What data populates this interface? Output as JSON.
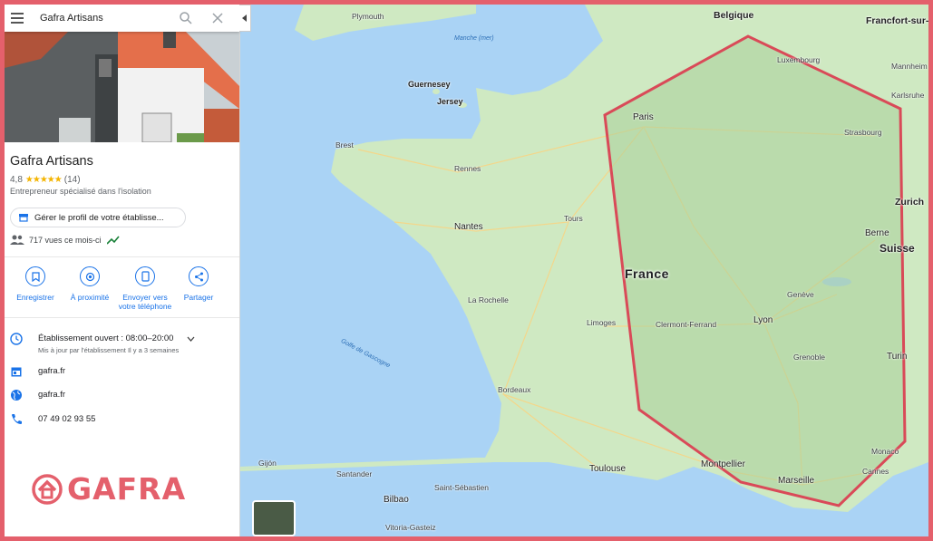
{
  "search": {
    "value": "Gafra Artisans"
  },
  "business": {
    "name": "Gafra Artisans",
    "rating": "4,8",
    "stars": "★★★★★",
    "review_count": "(14)",
    "category": "Entrepreneur spécialisé dans l'isolation",
    "manage_label": "Gérer le profil de votre établisse...",
    "views": "717 vues ce mois-ci"
  },
  "actions": [
    {
      "label": "Enregistrer"
    },
    {
      "label": "À proximité"
    },
    {
      "label": "Envoyer vers votre téléphone"
    },
    {
      "label": "Partager"
    }
  ],
  "info": {
    "hours": "Établissement ouvert : 08:00–20:00",
    "hours_note": "Mis à jour par l'établissement Il y a 3 semaines",
    "domain": "gafra.fr",
    "website": "gafra.fr",
    "phone": "07 49 02 93 55"
  },
  "logo": {
    "text": "GAFRA"
  },
  "map": {
    "country": "France",
    "cities": {
      "plymouth": "Plymouth",
      "belgique": "Belgique",
      "frankfurt": "Francfort-sur-le",
      "guernesey": "Guernesey",
      "jersey": "Jersey",
      "luxembourg": "Luxembourg",
      "mannheim": "Mannheim",
      "karlsruhe": "Karlsruhe",
      "paris": "Paris",
      "strasbourg": "Strasbourg",
      "brest": "Brest",
      "rennes": "Rennes",
      "zurich": "Zurich",
      "nantes": "Nantes",
      "tours": "Tours",
      "berne": "Berne",
      "suisse": "Suisse",
      "larochelle": "La Rochelle",
      "geneve": "Genève",
      "limoges": "Limoges",
      "clermont": "Clermont-Ferrand",
      "lyon": "Lyon",
      "grenoble": "Grenoble",
      "turin": "Turin",
      "bordeaux": "Bordeaux",
      "toulouse": "Toulouse",
      "montpellier": "Montpellier",
      "marseille": "Marseille",
      "monaco": "Monaco",
      "cannes": "Cannes",
      "gijon": "Gijón",
      "santander": "Santander",
      "sansebastian": "Saint-Sébastien",
      "bilbao": "Bilbao",
      "vitoria": "Vitoria-Gasteiz"
    },
    "waters": {
      "manche": "Manche (mer)",
      "gascogne": "Golfe de Gascogne"
    }
  },
  "colors": {
    "accent": "#1a73e8",
    "brand": "#e4606c",
    "polygon": "#d94a58",
    "star": "#f4b400",
    "sea": "#aad3f5",
    "land": "#cfe9c2",
    "area": "#a9cf9b"
  }
}
